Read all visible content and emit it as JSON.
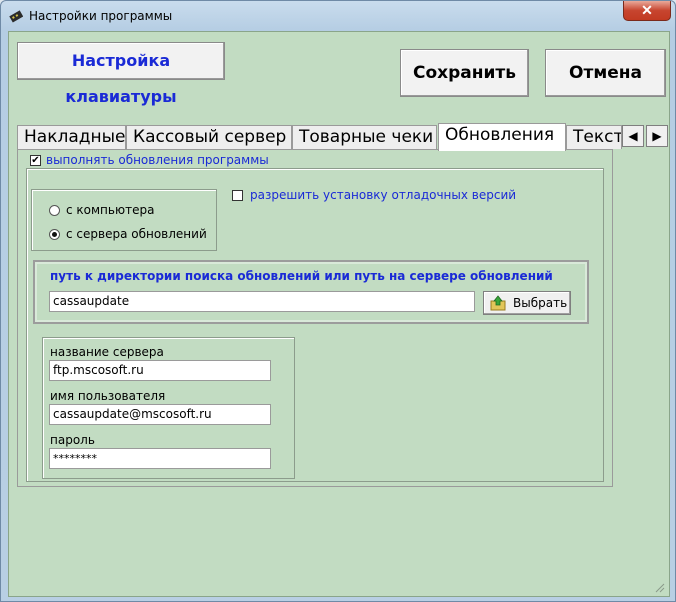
{
  "window": {
    "title": "Настройки программы",
    "close_label": "✕"
  },
  "toolbar": {
    "keyboard_button": "Настройка клавиатуры",
    "save_button": "Сохранить",
    "cancel_button": "Отмена"
  },
  "tabs": {
    "items": [
      {
        "label": "Накладные"
      },
      {
        "label": "Кассовый сервер"
      },
      {
        "label": "Товарные чеки"
      },
      {
        "label": "Обновления",
        "active": true
      },
      {
        "label": "Тексты"
      }
    ],
    "scroll_left": "◀",
    "scroll_right": "▶"
  },
  "updates": {
    "enable_label": "выполнять обновления программы",
    "enable_checked": true,
    "debug_label": "разрешить установку отладочных версий",
    "debug_checked": false,
    "source": {
      "options": [
        "с компьютера",
        "с сервера обновлений"
      ],
      "selected": "с сервера обновлений"
    },
    "path": {
      "label": "путь к директории поиска обновлений или путь на сервере обновлений",
      "value": "cassaupdate",
      "choose_button": "Выбрать"
    },
    "server": {
      "name_label": "название сервера",
      "name_value": "ftp.mscosoft.ru",
      "user_label": "имя пользователя",
      "user_value": "cassaupdate@mscosoft.ru",
      "password_label": "пароль",
      "password_value": "********"
    }
  },
  "colors": {
    "accent_text": "#1a2ad6",
    "panel_background": "#c2dcc2",
    "close_button": "#c7452f"
  },
  "icons": {
    "app": "app-icon",
    "choose": "folder-up-arrow-icon",
    "check": "✔"
  }
}
